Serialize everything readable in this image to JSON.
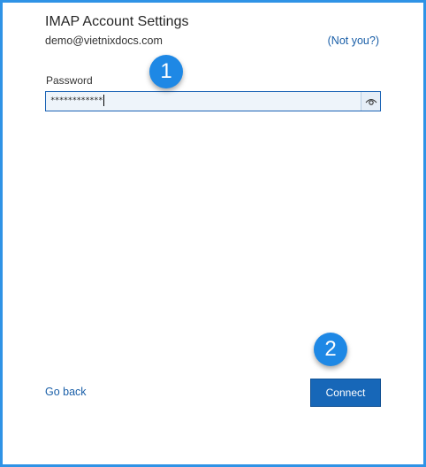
{
  "dialog": {
    "title": "IMAP Account Settings",
    "account_email": "demo@vietnixdocs.com",
    "not_you_link": "(Not you?)"
  },
  "password": {
    "label": "Password",
    "masked_value": "************",
    "reveal_icon": "eye-icon"
  },
  "annotations": {
    "step1": "1",
    "step2": "2",
    "badge_color": "#1e88e5"
  },
  "footer": {
    "go_back_label": "Go back",
    "connect_label": "Connect",
    "connect_color": "#1767b8"
  },
  "colors": {
    "frame_border": "#2f93e6",
    "link": "#1a5fa8"
  }
}
